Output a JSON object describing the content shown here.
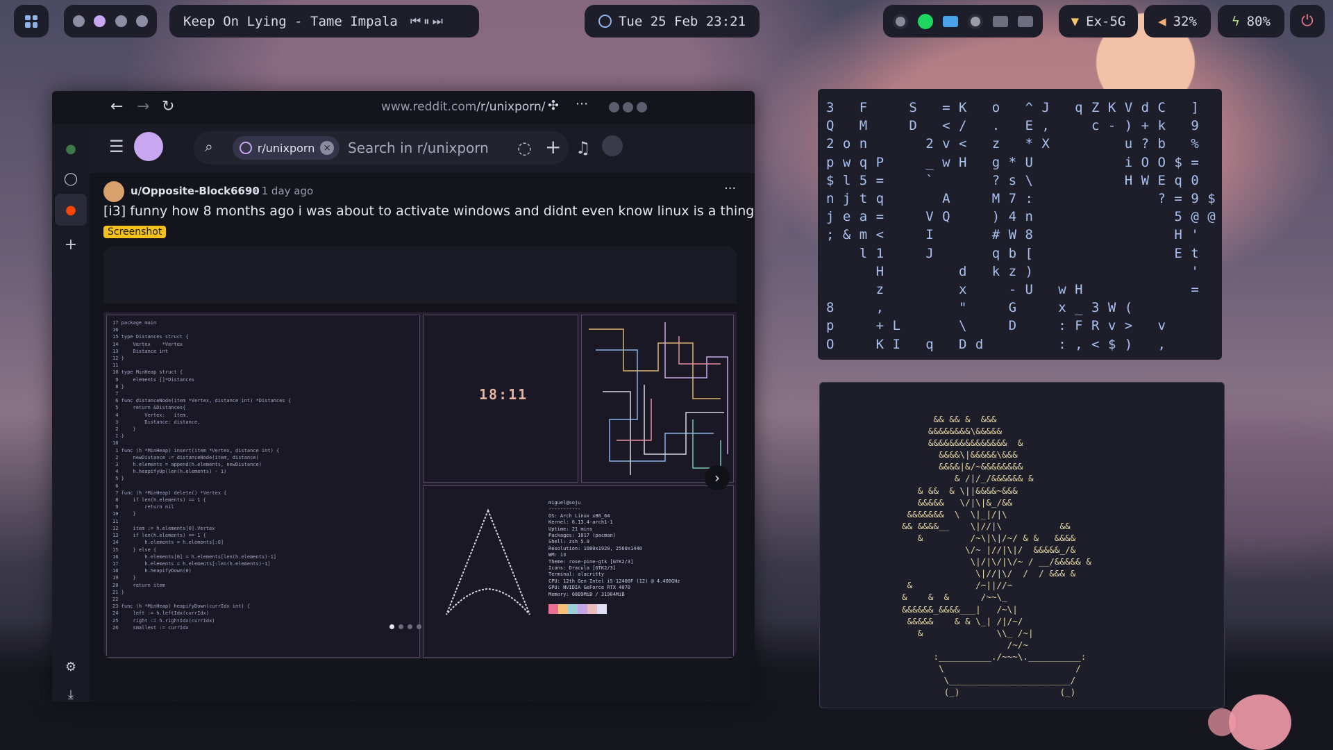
{
  "topbar": {
    "song": "Keep On Lying - Tame Impala",
    "prev": "⏮",
    "playpause": "⏸",
    "next": "⏭",
    "datetime": "Tue 25 Feb 23:21",
    "wifi_label": "Ex-5G",
    "volume": "32%",
    "battery": "80%",
    "power_icon": "⏻"
  },
  "browser": {
    "url_host": "www.reddit.com",
    "url_path": "/r/unixporn/",
    "subreddit_chip": "r/unixporn",
    "search_placeholder": "Search in r/unixporn",
    "post": {
      "user": "u/Opposite-Block6690",
      "time": "• 1 day ago",
      "title": "[i3] funny how 8 months ago i was about to activate windows and didnt even know linux is a thing",
      "flair": "Screenshot"
    },
    "screenshot": {
      "clock": "18:11",
      "code": "17 package main\n16\n15 type Distances struct {\n14     Vertex    *Vertex\n13     Distance int\n12 }\n11\n10 type MinHeap struct {\n 9     elements []*Distances\n 8 }\n 7\n 6 func distanceNode(item *Vertex, distance int) *Distances {\n 5     return &Distances{\n 4         Vertex:   item,\n 3         Distance: distance,\n 2     }\n 1 }\n18\n 1 func (h *MinHeap) insert(item *Vertex, distance int) {\n 2     newDistance := distanceNode(item, distance)\n 3     h.elements = append(h.elements, newDistance)\n 4     h.heapifyUp(len(h.elements) - 1)\n 5 }\n 6\n 7 func (h *MinHeap) delete() *Vertex {\n 8     if len(h.elements) == 1 {\n 9         return nil\n10     }\n11\n12     item := h.elements[0].Vertex\n13     if len(h.elements) == 1 {\n14         h.elements = h.elements[:0]\n15     } else {\n16         h.elements[0] = h.elements[len(h.elements)-1]\n17         h.elements = h.elements[:len(h.elements)-1]\n18         h.heapifyDown(0)\n19     }\n20     return item\n21 }\n22\n23 func (h *MinHeap) heapifyDown(currIdx int) {\n24     left := h.leftIdx(currIdx)\n25     right := h.rightIdx(currIdx)\n26     smallest := currIdx",
      "neofetch": "miguel@soju\n-----------\nOS: Arch Linux x86_64\nKernel: 6.13.4-arch1-1\nUptime: 21 mins\nPackages: 1017 (pacman)\nShell: zsh 5.9\nResolution: 1080x1920, 2560x1440\nWM: i3\nTheme: rose-pine-gtk [GTK2/3]\nIcons: Dracula [GTK2/3]\nTerminal: alacritty\nCPU: 12th Gen Intel i5-12400F (12) @ 4.400GHz\nGPU: NVIDIA GeForce RTX 4070\nMemory: 6889MiB / 31904MiB"
    }
  },
  "matrix_text": "3   F     S   = K   o   ^ J   q Z K V d C   ]\nQ   M     D   < /   .   E ,     c - ) + k   9\n2 o n       2 v <   z   * X         u ? b   %\np w q P     _ w H   g * U           i O O $ =\n$ l 5 =     `       ? s \\           H W E q 0\nn j t q       A     M 7 :               ? = 9 $\nj e a =     V Q     ) 4 n                 5 @ @\n; & m <     I       # W 8                 H '\n    l 1     J       q b [                 E t\n      H         d   k z )                   '\n      z         x     - U   w H             =\n8     ,         \"     G     x _ 3 W (\np     + L       \\     D     : F R v >   v\nO     K I   q   D d         : , < $ )   ,",
  "ascii_art": "      && && &  &&&\n     &&&&&&&&\\&&&&&\n     &&&&&&&&&&&&&&&  &\n       &&&&\\|&&&&&\\&&&\n       &&&&|&/~&&&&&&&&\n          & /|/_/&&&&&& &\n   & &&  & \\||&&&&~&&&\n   &&&&&   \\/|\\|&_/&&\n &&&&&&&  \\  \\|_|/|\\\n&& &&&&__    \\|//|\\           &&\n   &         /~\\|\\|/~/ & &   &&&&\n            \\/~ |//|\\|/  &&&&&_/&\n             \\|/|\\/|\\/~ / __/&&&&& &\n              \\|//|\\/  /  / &&& &\n &            /~||//~\n&    &  &      /~~\\_\n&&&&&&_&&&&___|   /~\\|\n &&&&&    & & \\_| /|/~/\n   &              \\\\_ /~|\n                    /~/~\n      :__________./~~~\\.__________:\n       \\                         /\n        \\_______________________/\n        (_)                   (_)"
}
